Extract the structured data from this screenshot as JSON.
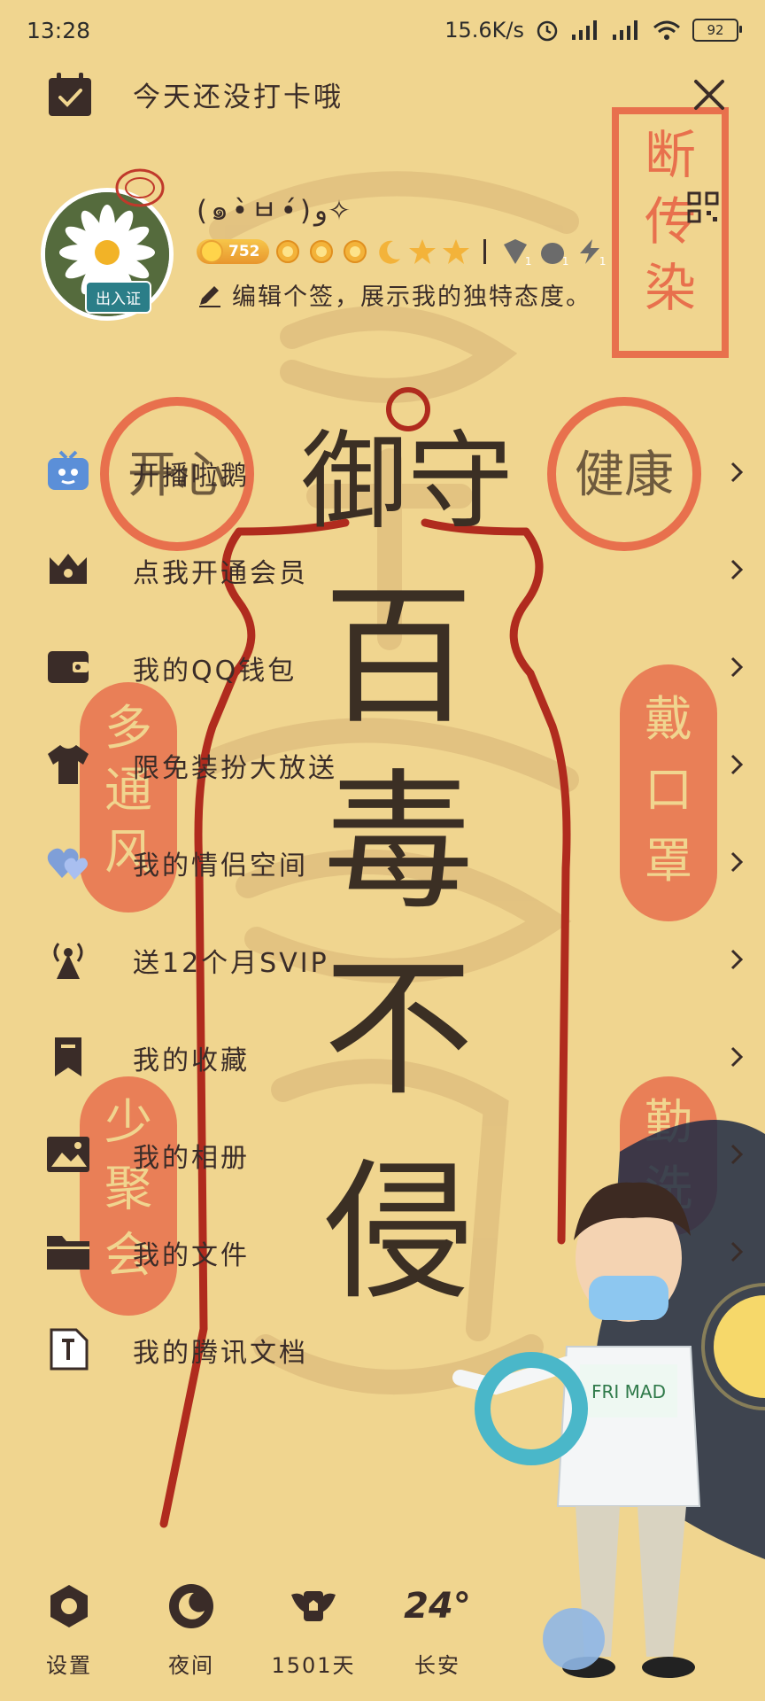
{
  "status_bar": {
    "time": "13:28",
    "network_speed": "15.6K/s",
    "battery": "92"
  },
  "top_bar": {
    "checkin_text": "今天还没打卡哦"
  },
  "profile": {
    "avatar_badge": "出入证",
    "nickname": "(๑•̀ㅂ•́)و✧",
    "coins": "752",
    "gem_counts": [
      "1",
      "1",
      "1"
    ],
    "signature": "编辑个签，展示我的独特态度。"
  },
  "menu": {
    "items": [
      {
        "label": "开播啦鹅",
        "icon": "tv-icon"
      },
      {
        "label": "点我开通会员",
        "icon": "crown-icon"
      },
      {
        "label": "我的QQ钱包",
        "icon": "wallet-icon"
      },
      {
        "label": "限免装扮大放送",
        "icon": "tshirt-icon"
      },
      {
        "label": "我的情侣空间",
        "icon": "hearts-icon"
      },
      {
        "label": "送12个月SVIP",
        "icon": "broadcast-icon"
      },
      {
        "label": "我的收藏",
        "icon": "bookmark-icon"
      },
      {
        "label": "我的相册",
        "icon": "photo-icon"
      },
      {
        "label": "我的文件",
        "icon": "folder-icon"
      },
      {
        "label": "我的腾讯文档",
        "icon": "document-icon"
      }
    ]
  },
  "bottom_bar": {
    "settings": "设置",
    "night": "夜间",
    "days": "1501天",
    "temperature": "24°",
    "city": "长安"
  },
  "poster": {
    "main_text": [
      "御守",
      "百",
      "毒",
      "不",
      "侵"
    ],
    "left_top": "开心",
    "right_top": "健康",
    "corner_stamp": "断传染",
    "left_mid": "多通风",
    "right_mid": "戴口罩",
    "left_low": "少聚会",
    "right_low": "勤洗"
  },
  "colors": {
    "background": "#F0D58F",
    "text": "#3A2C28",
    "seal_red": "#E8704D",
    "rope_red": "#B02B1E"
  }
}
